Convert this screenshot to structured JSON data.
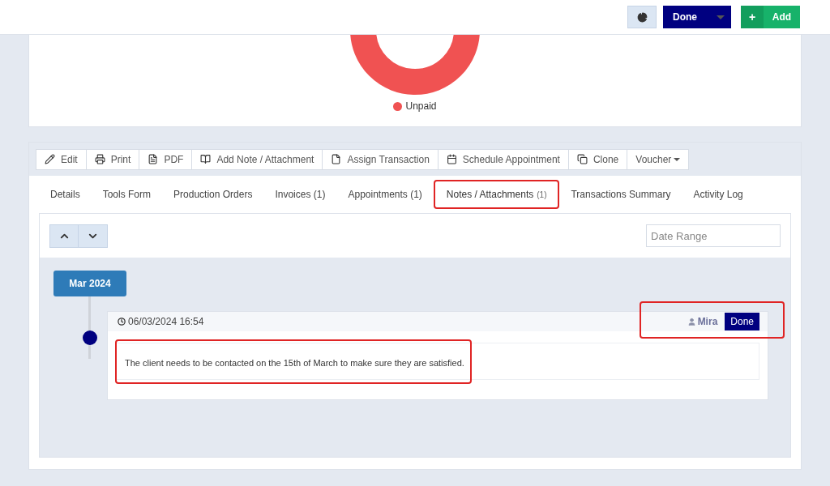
{
  "top_bar": {
    "status_button": "Done",
    "add_button": {
      "icon": "+",
      "label": "Add"
    }
  },
  "chart": {
    "legend": [
      {
        "label": "Unpaid",
        "color": "#f05252"
      }
    ]
  },
  "toolbar": [
    {
      "kind": "edit",
      "label": "Edit"
    },
    {
      "kind": "print",
      "label": "Print"
    },
    {
      "kind": "pdf",
      "label": "PDF"
    },
    {
      "kind": "note",
      "label": "Add Note / Attachment"
    },
    {
      "kind": "assign",
      "label": "Assign Transaction"
    },
    {
      "kind": "schedule",
      "label": "Schedule Appointment"
    },
    {
      "kind": "clone",
      "label": "Clone"
    },
    {
      "kind": "dropdown",
      "label": "Voucher"
    }
  ],
  "tabs": [
    {
      "label": "Details",
      "selected": false
    },
    {
      "label": "Tools Form",
      "selected": false
    },
    {
      "label": "Production Orders",
      "selected": false
    },
    {
      "label": "Invoices (1)",
      "selected": false
    },
    {
      "label": "Appointments (1)",
      "selected": false
    },
    {
      "label": "Notes / Attachments",
      "count": "(1)",
      "selected": true
    },
    {
      "label": "Transactions Summary",
      "selected": false
    },
    {
      "label": "Activity Log",
      "selected": false
    }
  ],
  "filter": {
    "placeholder": "Date Range"
  },
  "timeline": {
    "month": "Mar 2024",
    "notes": [
      {
        "datetime": "06/03/2024 16:54",
        "author": "Mira",
        "status": "Done",
        "text": "The client needs to be contacted on the 15th of March to make sure they are satisfied."
      }
    ]
  }
}
